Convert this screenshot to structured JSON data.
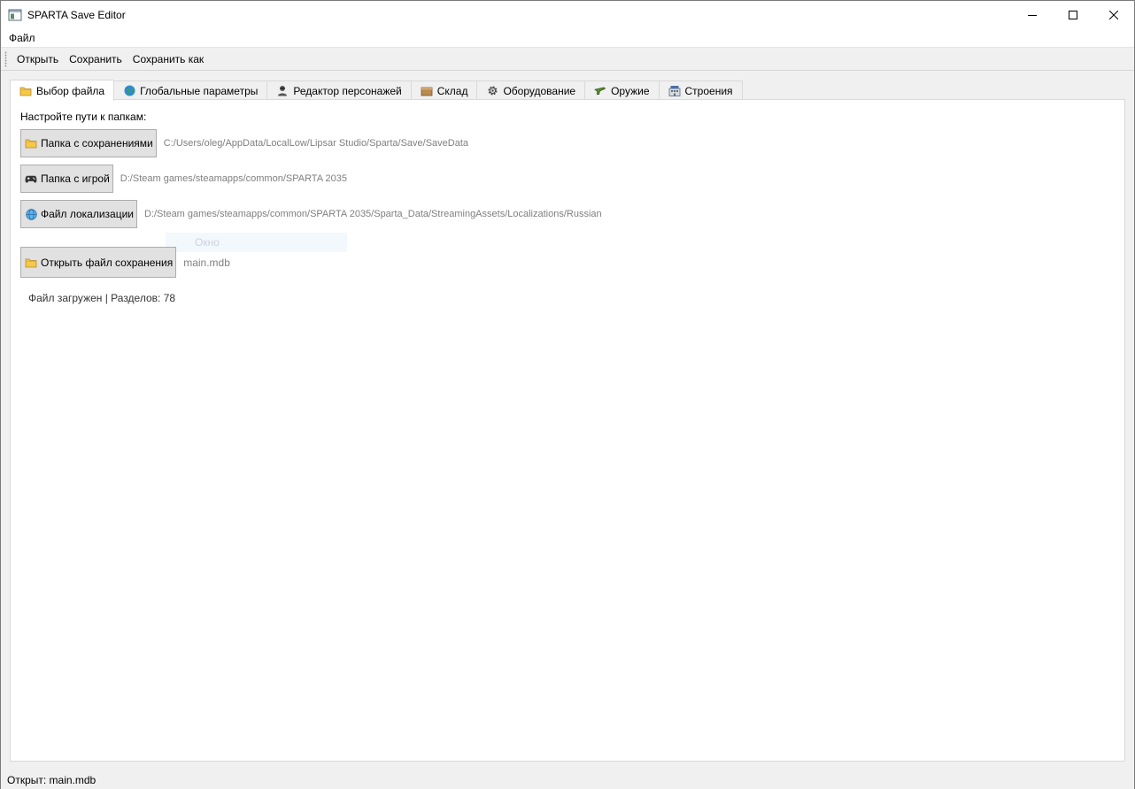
{
  "window": {
    "title": "SPARTA Save Editor",
    "minimize_glyph": "—",
    "maximize_glyph": "☐",
    "close_glyph": "✕"
  },
  "menubar": {
    "items": [
      {
        "label": "Файл"
      }
    ]
  },
  "toolbar": {
    "items": [
      {
        "label": "Открыть"
      },
      {
        "label": "Сохранить"
      },
      {
        "label": "Сохранить как"
      }
    ]
  },
  "tabs": [
    {
      "label": "Выбор файла",
      "icon": "folder-icon",
      "active": true
    },
    {
      "label": "Глобальные параметры",
      "icon": "globe-icon",
      "active": false
    },
    {
      "label": "Редактор персонажей",
      "icon": "person-icon",
      "active": false
    },
    {
      "label": "Склад",
      "icon": "box-icon",
      "active": false
    },
    {
      "label": "Оборудование",
      "icon": "gear-icon",
      "active": false
    },
    {
      "label": "Оружие",
      "icon": "gun-icon",
      "active": false
    },
    {
      "label": "Строения",
      "icon": "building-icon",
      "active": false
    }
  ],
  "file_tab": {
    "prompt": "Настройте пути к папкам:",
    "saves_folder": {
      "button": "Папка с сохранениями",
      "icon": "folder-icon",
      "path": "C:/Users/oleg/AppData/LocalLow/Lipsar Studio/Sparta/Save/SaveData"
    },
    "game_folder": {
      "button": "Папка с игрой",
      "icon": "gamepad-icon",
      "path": "D:/Steam games/steamapps/common/SPARTA 2035"
    },
    "localization": {
      "button": "Файл локализации",
      "icon": "globe-icon",
      "path": "D:/Steam games/steamapps/common/SPARTA 2035/Sparta_Data/StreamingAssets/Localizations/Russian"
    },
    "ghost_label": "Окно",
    "open_save": {
      "button": "Открыть файл сохранения",
      "icon": "folder-icon",
      "file": "main.mdb"
    },
    "status": "Файл загружен | Разделов: 78"
  },
  "statusbar": {
    "text": "Открыт: main.mdb"
  }
}
